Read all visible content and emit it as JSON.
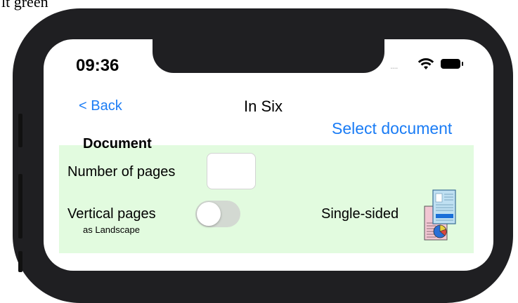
{
  "caption": "lt green",
  "status_bar": {
    "time": "09:36",
    "signal": "....",
    "wifi_icon": "wifi-icon",
    "battery_icon": "battery-icon"
  },
  "nav": {
    "back_label": "< Back",
    "title": "In Six",
    "select_label": "Select document"
  },
  "document_section": {
    "heading": "Document",
    "background_color": "#e2fbdf",
    "pages_label": "Number of pages",
    "pages_value": "",
    "vertical_label": "Vertical pages",
    "vertical_sublabel": "as Landscape",
    "vertical_on": false,
    "sided_label": "Single-sided",
    "sided_icon": "single-sided-layout-icon"
  },
  "colors": {
    "link": "#1a7cf5",
    "panel": "#e2fbdf",
    "bezel": "#1f1f22"
  }
}
